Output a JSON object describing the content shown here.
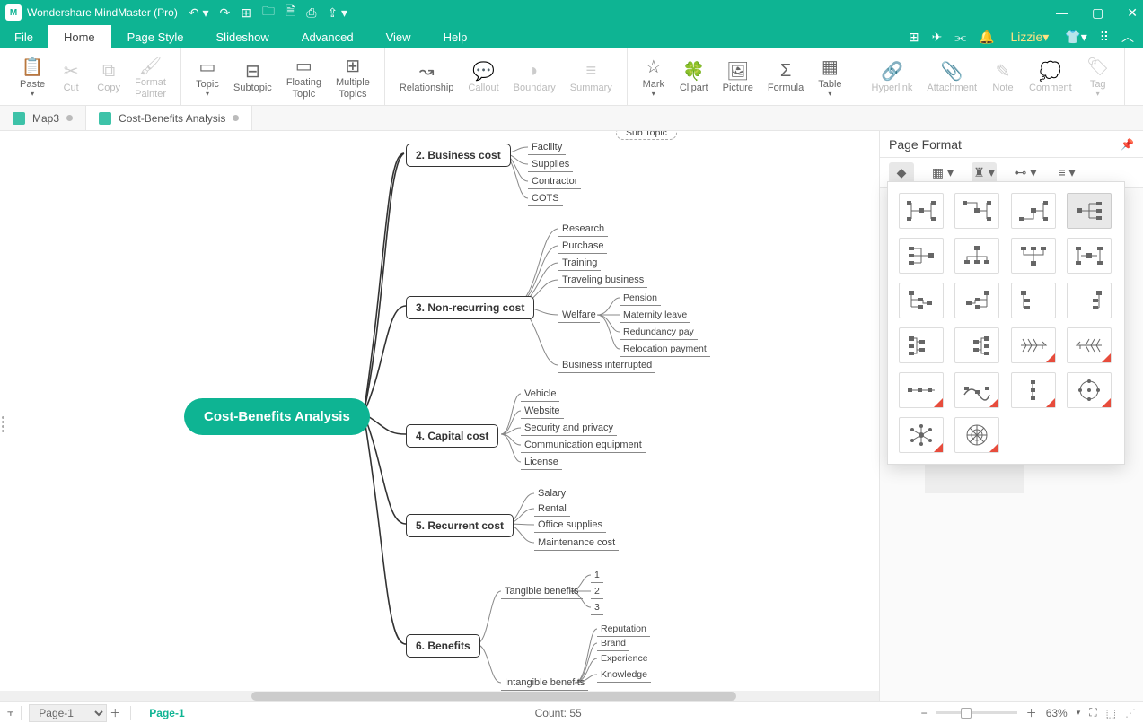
{
  "app": {
    "title": "Wondershare MindMaster (Pro)"
  },
  "menus": {
    "file": "File",
    "home": "Home",
    "pagestyle": "Page Style",
    "slideshow": "Slideshow",
    "advanced": "Advanced",
    "view": "View",
    "help": "Help",
    "user": "Lizzie"
  },
  "ribbon": {
    "paste": "Paste",
    "cut": "Cut",
    "copy": "Copy",
    "formatpainter": "Format\nPainter",
    "topic": "Topic",
    "subtopic": "Subtopic",
    "floating": "Floating\nTopic",
    "multiple": "Multiple\nTopics",
    "relationship": "Relationship",
    "callout": "Callout",
    "boundary": "Boundary",
    "summary": "Summary",
    "mark": "Mark",
    "clipart": "Clipart",
    "picture": "Picture",
    "formula": "Formula",
    "table": "Table",
    "hyperlink": "Hyperlink",
    "attachment": "Attachment",
    "note": "Note",
    "comment": "Comment",
    "tag": "Tag"
  },
  "tabs": {
    "map3": "Map3",
    "cba": "Cost-Benefits Analysis"
  },
  "side": {
    "title": "Page Format"
  },
  "status": {
    "pagecombo": "Page-1",
    "pagetab": "Page-1",
    "count": "Count: 55",
    "zoom": "63%"
  },
  "mindmap": {
    "root": "Cost-Benefits Analysis",
    "n_subtopic": "Sub Topic",
    "n2": "2. Business cost",
    "n2_items": {
      "a": "Facility",
      "b": "Supplies",
      "c": "Contractor",
      "d": "COTS"
    },
    "n3": "3. Non-recurring cost",
    "n3_items": {
      "a": "Research",
      "b": "Purchase",
      "c": "Training",
      "d": "Traveling business",
      "e": "Welfare",
      "f": "Business interrupted"
    },
    "n3_welfare": {
      "a": "Pension",
      "b": "Maternity leave",
      "c": "Redundancy pay",
      "d": "Relocation payment"
    },
    "n4": "4. Capital cost",
    "n4_items": {
      "a": "Vehicle",
      "b": "Website",
      "c": "Security and privacy",
      "d": "Communication equipment",
      "e": "License"
    },
    "n5": "5. Recurrent cost",
    "n5_items": {
      "a": "Salary",
      "b": "Rental",
      "c": "Office supplies",
      "d": "Maintenance cost"
    },
    "n6": "6. Benefits",
    "n6_tang": "Tangible benefits",
    "n6_tang_items": {
      "a": "1",
      "b": "2",
      "c": "3"
    },
    "n6_intang": "Intangible benefits",
    "n6_intang_items": {
      "a": "Reputation",
      "b": "Brand",
      "c": "Experience",
      "d": "Knowledge"
    }
  }
}
